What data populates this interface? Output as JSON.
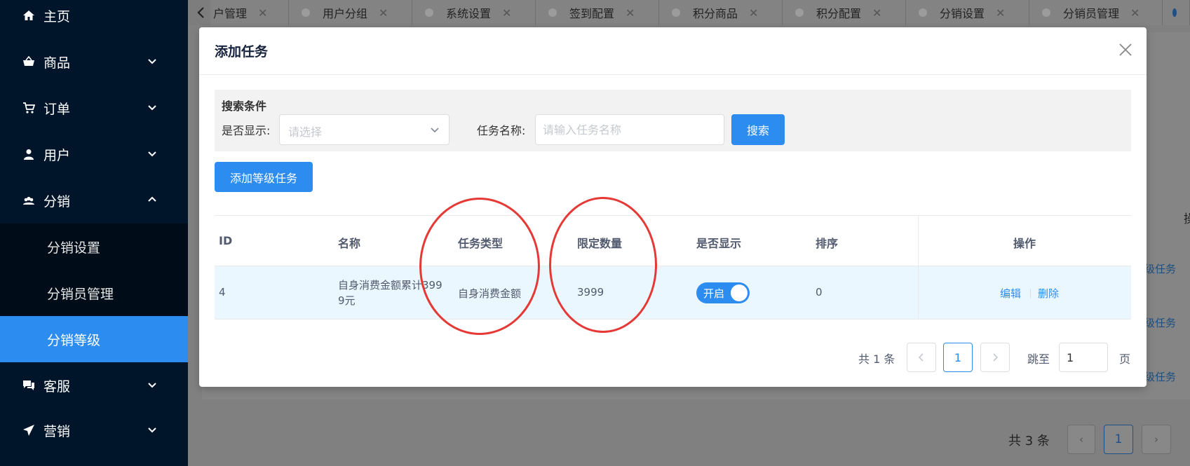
{
  "sidebar": {
    "items": [
      {
        "label": "主页"
      },
      {
        "label": "商品"
      },
      {
        "label": "订单"
      },
      {
        "label": "用户"
      },
      {
        "label": "分销"
      },
      {
        "label": "客服"
      },
      {
        "label": "营销"
      }
    ],
    "submenu": [
      {
        "label": "分销设置"
      },
      {
        "label": "分销员管理"
      },
      {
        "label": "分销等级"
      }
    ]
  },
  "tabs": [
    {
      "label": "户管理"
    },
    {
      "label": "用户分组"
    },
    {
      "label": "系统设置"
    },
    {
      "label": "签到配置"
    },
    {
      "label": "积分商品"
    },
    {
      "label": "积分配置"
    },
    {
      "label": "分销设置"
    },
    {
      "label": "分销员管理"
    }
  ],
  "background": {
    "col_header_partial": "操",
    "row_links": [
      "级任务",
      "级任务",
      "级任务"
    ],
    "total": "共 3 条",
    "page": "1"
  },
  "modal": {
    "title": "添加任务",
    "search": {
      "title": "搜索条件",
      "show_label": "是否显示:",
      "show_placeholder": "请选择",
      "name_label": "任务名称:",
      "name_placeholder": "请输入任务名称",
      "search_button": "搜索"
    },
    "add_button": "添加等级任务",
    "table": {
      "headers": [
        "ID",
        "名称",
        "任务类型",
        "限定数量",
        "是否显示",
        "排序",
        "操作"
      ],
      "rows": [
        {
          "id": "4",
          "name_line1": "自身消费金额累计399",
          "name_line2": "9元",
          "type": "自身消费金额",
          "limit": "3999",
          "switch_label": "开启",
          "switch_on": true,
          "sort": "0",
          "edit": "编辑",
          "delete": "删除"
        }
      ]
    },
    "pagination": {
      "total": "共 1 条",
      "current": "1",
      "jump_label": "跳至",
      "jump_value": "1",
      "page_suffix": "页"
    }
  },
  "colors": {
    "primary": "#2d8cf0",
    "sidebar_bg": "#001529",
    "annotation": "#e53935"
  }
}
